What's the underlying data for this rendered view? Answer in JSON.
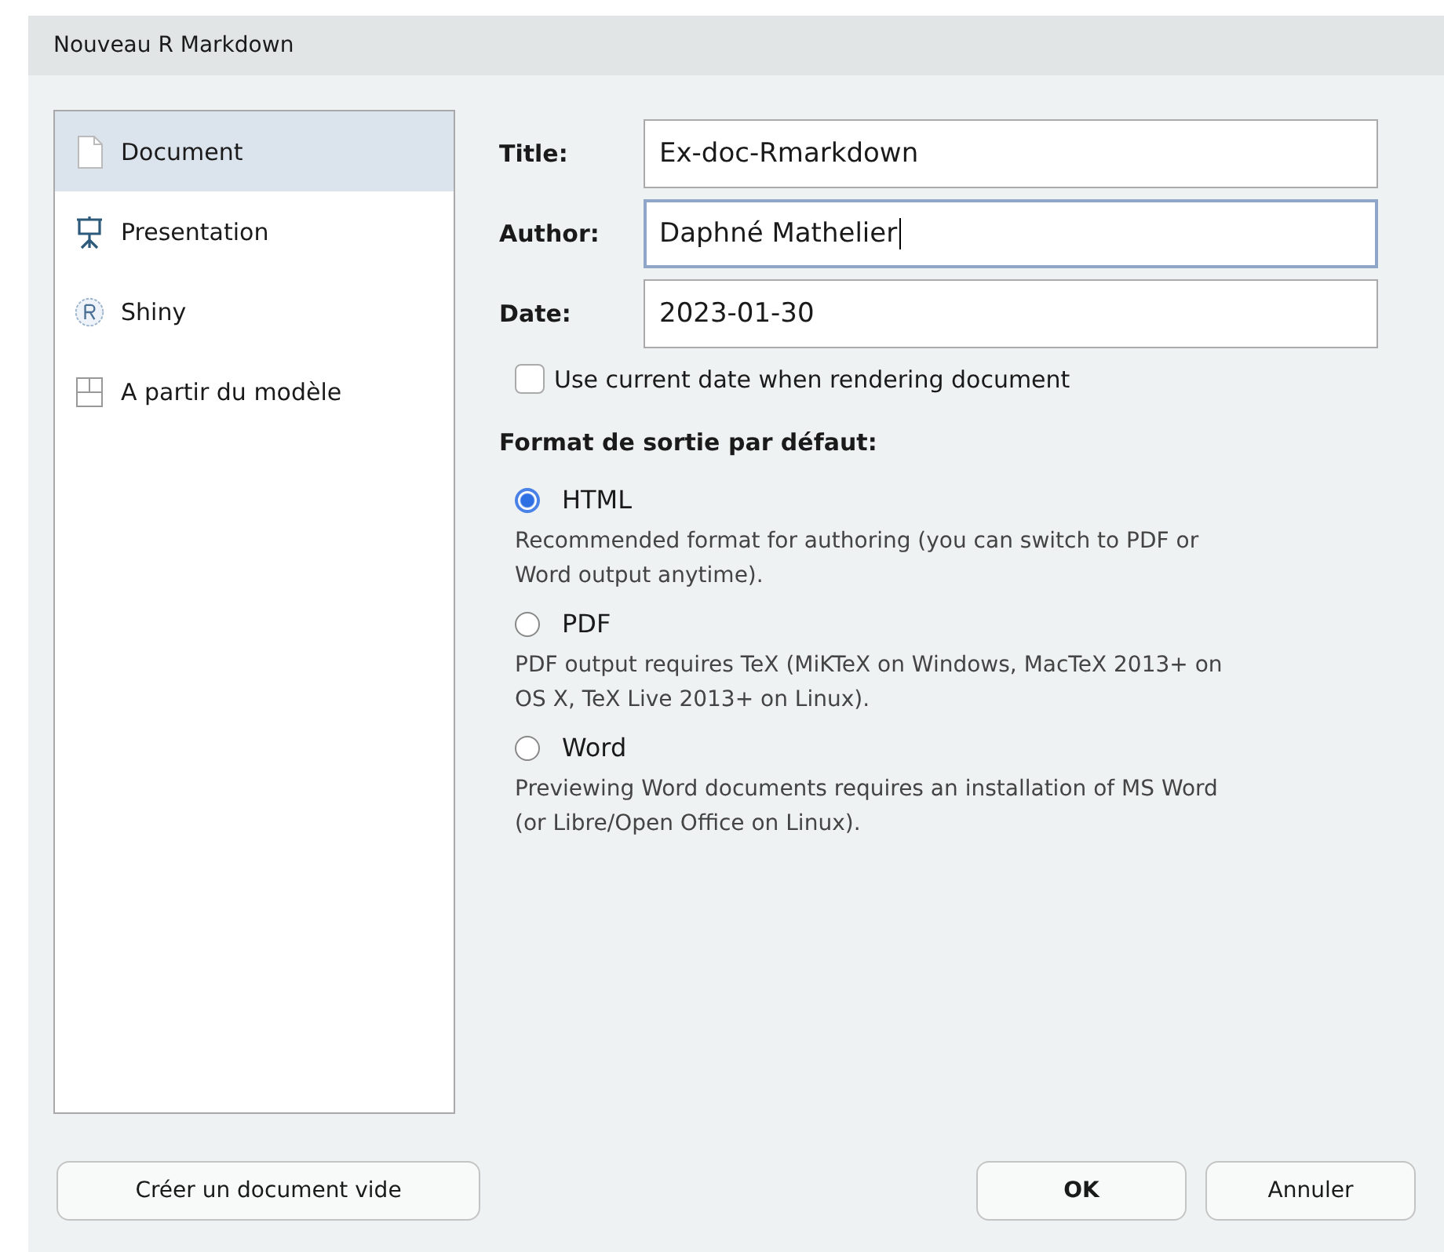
{
  "window": {
    "title": "Nouveau R Markdown"
  },
  "sidebar": {
    "items": [
      {
        "label": "Document",
        "kind": "document",
        "selected": true
      },
      {
        "label": "Presentation",
        "kind": "presentation",
        "selected": false
      },
      {
        "label": "Shiny",
        "kind": "shiny",
        "selected": false
      },
      {
        "label": "A partir du modèle",
        "kind": "template",
        "selected": false
      }
    ]
  },
  "fields": [
    {
      "label": "Title:",
      "value": "Ex-doc-Rmarkdown",
      "focused": false
    },
    {
      "label": "Author:",
      "value": "Daphné Mathelier",
      "focused": true
    },
    {
      "label": "Date:",
      "value": "2023-01-30",
      "focused": false
    }
  ],
  "current_date_checkbox": {
    "label": "Use current date when rendering document",
    "checked": false
  },
  "format": {
    "heading": "Format de sortie par défaut:",
    "options": [
      {
        "label": "HTML",
        "description": "Recommended format for authoring (you can switch to PDF or Word output anytime).",
        "selected": true
      },
      {
        "label": "PDF",
        "description": "PDF output requires TeX (MiKTeX on Windows, MacTeX 2013+ on OS X, TeX Live 2013+ on Linux).",
        "selected": false
      },
      {
        "label": "Word",
        "description": "Previewing Word documents requires an installation of MS Word (or Libre/Open Office on Linux).",
        "selected": false
      }
    ]
  },
  "buttons": {
    "left": "Créer un document vide",
    "ok": "OK",
    "cancel": "Annuler"
  }
}
